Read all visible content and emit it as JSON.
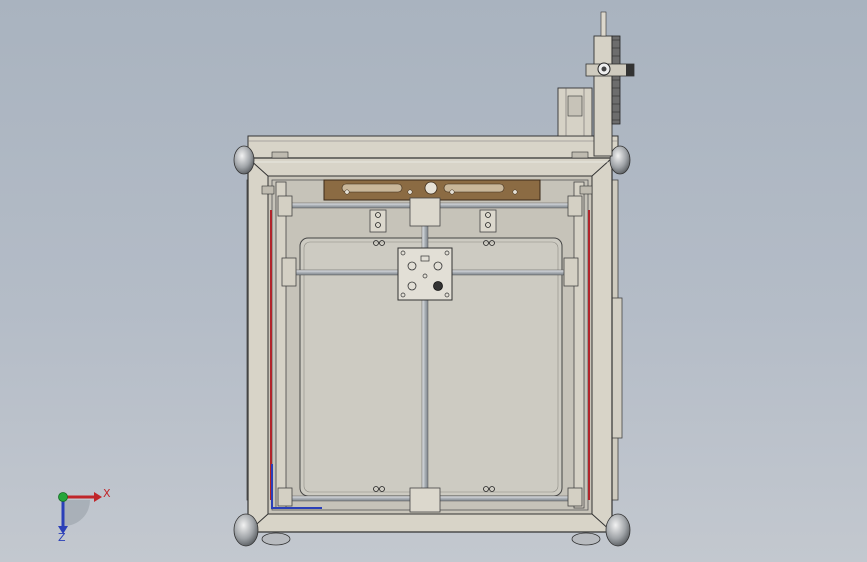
{
  "viewport": {
    "background_top": "#a9b3bf",
    "background_bottom": "#c3c8cf"
  },
  "model": {
    "frame_color": "#d8d4c8",
    "frame_edge_color": "#3a3a3a",
    "bed_color": "#cdcbc2",
    "carriage_plate_color": "#e2dfd6",
    "gantry_plate_color": "#8b6b43",
    "rod_color": "#b8bcc0",
    "belt_left_color": "#b0242a",
    "belt_right_color": "#b0242a",
    "blue_edge_color": "#2a3fb8"
  },
  "triad": {
    "x_label": "X",
    "z_label": "Z",
    "x_color": "#c0262a",
    "y_color": "#26a63a",
    "z_color": "#2a3fb8",
    "icons": [
      "x-axis-arrow-icon",
      "y-axis-dot-icon",
      "z-axis-arrow-icon"
    ]
  }
}
